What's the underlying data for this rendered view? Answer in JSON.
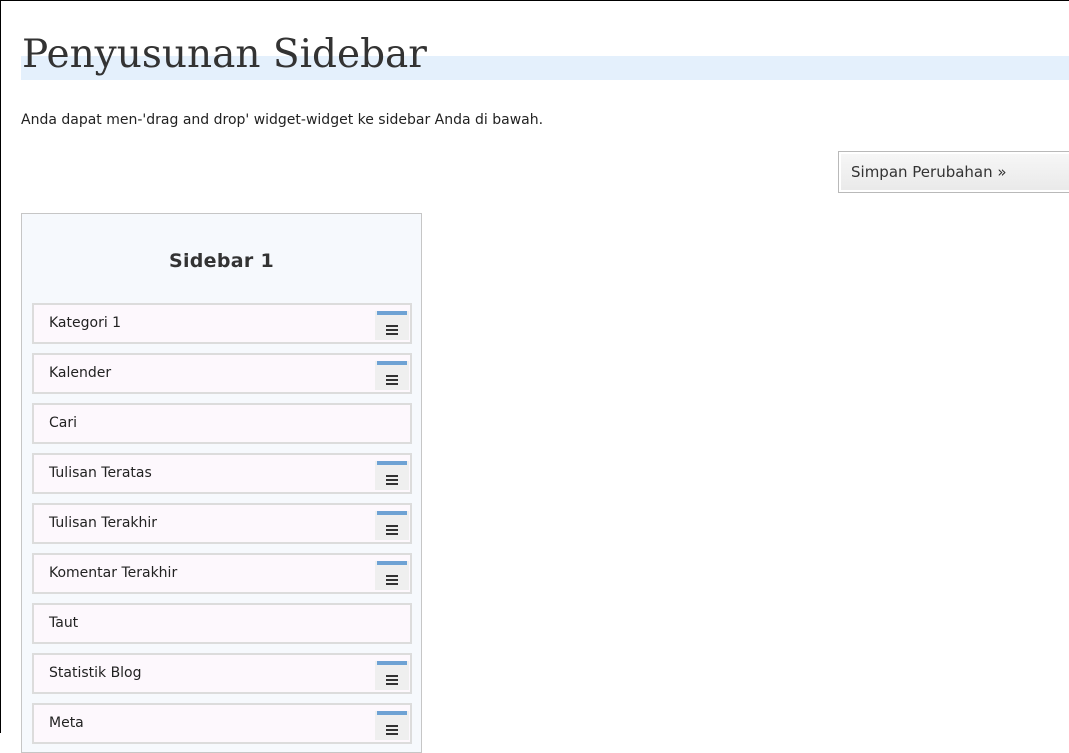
{
  "page": {
    "title": "Penyusunan Sidebar",
    "instruction": "Anda dapat men-'drag and drop' widget-widget ke sidebar Anda di bawah.",
    "save_button_label": "Simpan Perubahan »"
  },
  "sidebar": {
    "title": "Sidebar 1",
    "widgets": [
      {
        "label": "Kategori 1",
        "has_handle": true
      },
      {
        "label": "Kalender",
        "has_handle": true
      },
      {
        "label": "Cari",
        "has_handle": false
      },
      {
        "label": "Tulisan Teratas",
        "has_handle": true
      },
      {
        "label": "Tulisan Terakhir",
        "has_handle": true
      },
      {
        "label": "Komentar Terakhir",
        "has_handle": true
      },
      {
        "label": "Taut",
        "has_handle": false
      },
      {
        "label": "Statistik Blog",
        "has_handle": true
      },
      {
        "label": "Meta",
        "has_handle": true
      }
    ]
  },
  "colors": {
    "title_band": "#e4f0fc",
    "panel_background": "#f6f9fd",
    "widget_background": "#fdf8fd",
    "handle_accent": "#6ea2d4"
  },
  "icons": {
    "widget_handle": "menu-lines-icon"
  }
}
